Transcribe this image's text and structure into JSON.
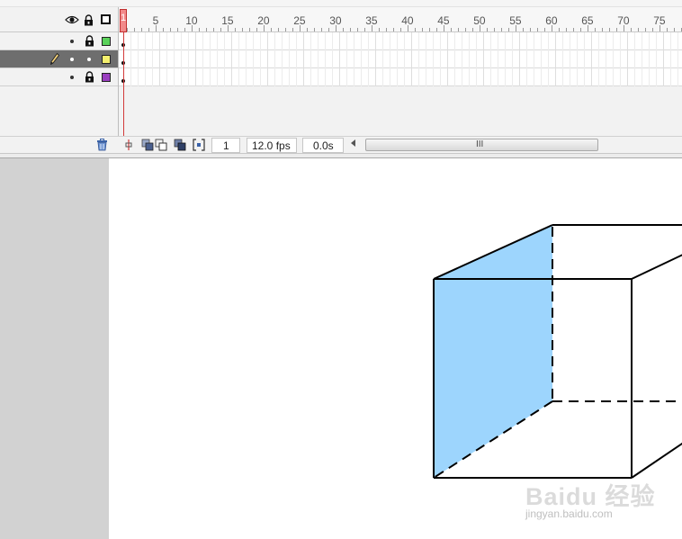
{
  "layers": [
    {
      "label": "",
      "color": "#5ad25a",
      "selected": false
    },
    {
      "label": "",
      "color": "#f5f06e",
      "selected": true
    },
    {
      "label": "",
      "color": "#9a3fc0",
      "selected": false
    }
  ],
  "ruler": {
    "marks": [
      "1",
      "5",
      "10",
      "15",
      "20",
      "25",
      "30",
      "35",
      "40",
      "45",
      "50",
      "55",
      "60",
      "65",
      "70",
      "75"
    ]
  },
  "controls": {
    "current_frame": "1",
    "frame_rate": "12.0 fps",
    "elapsed_time": "0.0s",
    "scroll_grip": "III"
  },
  "colors": {
    "selected_layer_bg": "#6e6e6e",
    "playhead": "#f28a8a",
    "cube_face_fill": "#9dd5fd",
    "pasteboard": "#d2d2d2"
  },
  "watermark": {
    "brand": "Baidu 经验",
    "url": "jingyan.baidu.com"
  },
  "icons": [
    "eye-icon",
    "lock-icon",
    "outline-icon",
    "pencil-icon",
    "trash-icon",
    "center-frame-icon",
    "onion-skin-icon",
    "onion-skin-outlines-icon",
    "edit-multiple-frames-icon",
    "onion-markers-icon"
  ]
}
